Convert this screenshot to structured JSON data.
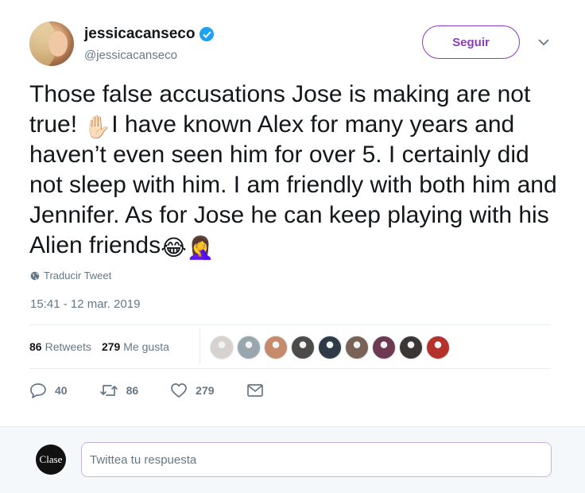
{
  "user": {
    "display_name": "jessicacanseco",
    "handle": "@jessicacanseco",
    "verified": true
  },
  "follow_button": {
    "label": "Seguir",
    "color": "#8e3bbd"
  },
  "tweet": {
    "segments": [
      {
        "type": "text",
        "value": "Those false accusations Jose is making are not true! "
      },
      {
        "type": "emoji",
        "value": "✋🏻",
        "icon": "raised-hand-icon"
      },
      {
        "type": "text",
        "value": "I have  known Alex for many years and haven’t even seen him for over 5. I certainly did not sleep with him. I am friendly with both him and Jennifer. As for Jose he can keep playing with his Alien friends"
      },
      {
        "type": "emoji",
        "value": "😂",
        "icon": "tears-of-joy-emoji-icon"
      },
      {
        "type": "emoji",
        "value": "🤦‍♀️",
        "icon": "facepalm-emoji-icon"
      }
    ],
    "translate_label": "Traducir Tweet",
    "timestamp": "15:41 - 12 mar. 2019"
  },
  "stats": {
    "retweets_count": "86",
    "retweets_label": "Retweets",
    "likes_count": "279",
    "likes_label": "Me gusta",
    "likers": [
      {
        "color": "#d7d2cf"
      },
      {
        "color": "#9aa6ad"
      },
      {
        "color": "#c58b6a"
      },
      {
        "color": "#4d4b4a"
      },
      {
        "color": "#2e3a45"
      },
      {
        "color": "#7a6256"
      },
      {
        "color": "#6d3a52"
      },
      {
        "color": "#3b3635"
      },
      {
        "color": "#b5312a"
      }
    ]
  },
  "actions": {
    "replies": "40",
    "retweets": "86",
    "likes": "279"
  },
  "reply": {
    "avatar_text": "Clase",
    "placeholder": "Twittea tu respuesta"
  }
}
